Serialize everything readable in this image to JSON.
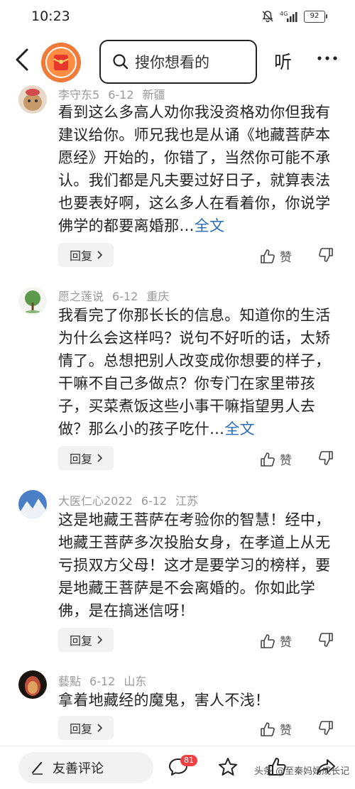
{
  "status_bar": {
    "time": "10:23",
    "network": "4G",
    "battery": "92",
    "icons": [
      "mute-icon",
      "signal-icon",
      "battery-icon"
    ]
  },
  "header": {
    "back_icon": "chevron-left-icon",
    "search_placeholder": "搜你想看的",
    "listen_label": "听",
    "more_icon": "more-dots-icon"
  },
  "comments": [
    {
      "author": "李守东5",
      "date": "6-12",
      "location": "新疆",
      "text": "看到这么多高人劝你我没资格劝你但我有建议给你。师兄我也是从诵《地藏菩萨本愿经》开始的，你错了，当然你可能不承认。我们都是凡夫要过好日子，就算表法也要表好啊，这么多人在看着你，你说学佛学的都要离婚那…",
      "full_link": "全文",
      "reply_label": "回复",
      "like_label": "赞"
    },
    {
      "author": "愿之莲说",
      "date": "6-12",
      "location": "重庆",
      "text": "我看完了你那长长的信息。知道你的生活为什么会这样吗？说句不好听的话，太矫情了。总想把别人改变成你想要的样子，干嘛不自己多做点？你专门在家里带孩子，买菜煮饭这些小事干嘛指望男人去做？那么小的孩子吃什…",
      "full_link": "全文",
      "reply_label": "回复",
      "like_label": "赞"
    },
    {
      "author": "大医仁心2022",
      "date": "6-12",
      "location": "江苏",
      "text": "这是地藏王菩萨在考验你的智慧！经中，地藏王菩萨多次投胎女身，在孝道上从无亏损双方父母！这才是要学习的榜样，要是地藏王菩萨是不会离婚的。你如此学佛，是在搞迷信呀！",
      "full_link": "",
      "reply_label": "回复",
      "like_label": "赞"
    },
    {
      "author": "藝點",
      "date": "6-12",
      "location": "山东",
      "text": "拿着地藏经的魔鬼，害人不浅！",
      "full_link": "",
      "reply_label": "回复",
      "like_label": "赞"
    }
  ],
  "bottom_bar": {
    "comment_placeholder": "友善评论",
    "comment_count": "81",
    "watermark": "头条 @至秦妈妈成长记"
  },
  "colors": {
    "link": "#2a6bb8",
    "badge": "#f04142",
    "brand_orange": "#f07a3a"
  }
}
